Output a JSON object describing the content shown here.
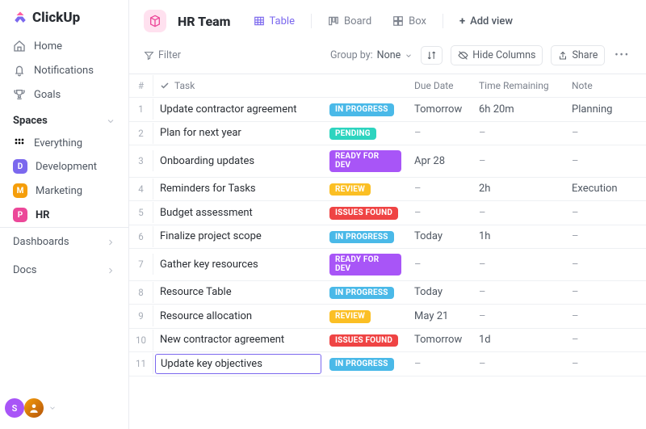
{
  "brand": {
    "name": "ClickUp"
  },
  "sidebar": {
    "nav": {
      "home": "Home",
      "notifications": "Notifications",
      "goals": "Goals"
    },
    "spaces_label": "Spaces",
    "everything": "Everything",
    "spaces": [
      {
        "initial": "D",
        "label": "Development",
        "color": "#7b68ee"
      },
      {
        "initial": "M",
        "label": "Marketing",
        "color": "#f59e0b"
      },
      {
        "initial": "P",
        "label": "HR",
        "color": "#ec4899",
        "active": true
      }
    ],
    "dashboards": "Dashboards",
    "docs": "Docs",
    "avatars": {
      "first": "S"
    }
  },
  "header": {
    "title": "HR Team",
    "views": {
      "table": "Table",
      "board": "Board",
      "box": "Box",
      "add": "Add view"
    }
  },
  "toolbar": {
    "filter": "Filter",
    "groupby_label": "Group by:",
    "groupby_value": "None",
    "hide_columns": "Hide Columns",
    "share": "Share"
  },
  "table": {
    "columns": {
      "num": "#",
      "task": "Task",
      "due": "Due Date",
      "remain": "Time Remaining",
      "note": "Note"
    },
    "rows": [
      {
        "n": "1",
        "task": "Update contractor agreement",
        "status": "IN PROGRESS",
        "due": "Tomorrow",
        "due_red": false,
        "remain": "6h 20m",
        "note": "Planning"
      },
      {
        "n": "2",
        "task": "Plan for next year",
        "status": "PENDING",
        "due": "–",
        "due_red": false,
        "remain": "–",
        "note": "–"
      },
      {
        "n": "3",
        "task": "Onboarding updates",
        "status": "READY FOR DEV",
        "due": "Apr 28",
        "due_red": true,
        "remain": "–",
        "note": "–"
      },
      {
        "n": "4",
        "task": "Reminders for Tasks",
        "status": "REVIEW",
        "due": "–",
        "due_red": false,
        "remain": "2h",
        "note": "Execution"
      },
      {
        "n": "5",
        "task": "Budget assessment",
        "status": "ISSUES FOUND",
        "due": "–",
        "due_red": false,
        "remain": "–",
        "note": "–"
      },
      {
        "n": "6",
        "task": "Finalize project scope",
        "status": "IN PROGRESS",
        "due": "Today",
        "due_red": true,
        "remain": "1h",
        "note": "–"
      },
      {
        "n": "7",
        "task": "Gather key resources",
        "status": "READY FOR DEV",
        "due": "–",
        "due_red": false,
        "remain": "–",
        "note": "–"
      },
      {
        "n": "8",
        "task": "Resource Table",
        "status": "IN PROGRESS",
        "due": "Today",
        "due_red": true,
        "remain": "–",
        "note": "–"
      },
      {
        "n": "9",
        "task": "Resource allocation",
        "status": "REVIEW",
        "due": "May 21",
        "due_red": false,
        "remain": "–",
        "note": "–"
      },
      {
        "n": "10",
        "task": "New contractor agreement",
        "status": "ISSUES FOUND",
        "due": "Tomorrow",
        "due_red": false,
        "remain": "1d",
        "note": "–"
      },
      {
        "n": "11",
        "task": "Update key objectives",
        "status": "IN PROGRESS",
        "due": "–",
        "due_red": false,
        "remain": "–",
        "note": "–",
        "editing": true
      }
    ]
  },
  "status_styles": {
    "IN PROGRESS": "c-inprogress",
    "PENDING": "c-pending",
    "READY FOR DEV": "c-ready",
    "REVIEW": "c-review",
    "ISSUES FOUND": "c-issues"
  }
}
